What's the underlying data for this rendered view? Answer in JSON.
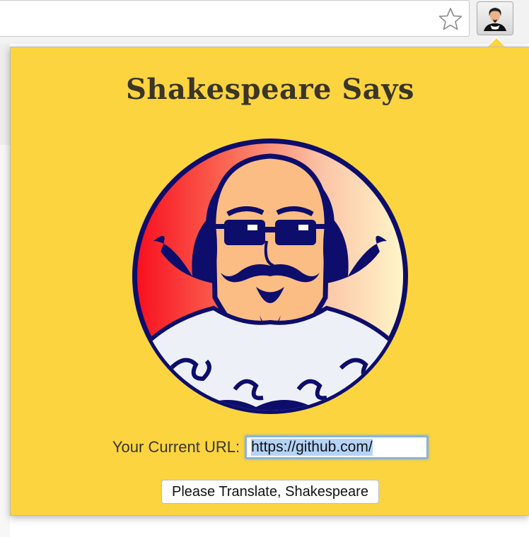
{
  "toolbar": {
    "bookmark_icon": "star-icon",
    "extension_icon": "shakespeare-icon"
  },
  "popup": {
    "title": "Shakespeare Says",
    "logo_icon": "shakespeare-logo",
    "url_label": "Your Current URL:",
    "url_value": "https://github.com/",
    "translate_button": "Please Translate, Shakespeare"
  },
  "colors": {
    "popup_background": "#fbd440",
    "title_color": "#3a3526",
    "logo_border": "#0d0d6b",
    "input_focus": "#7fb3e8"
  }
}
